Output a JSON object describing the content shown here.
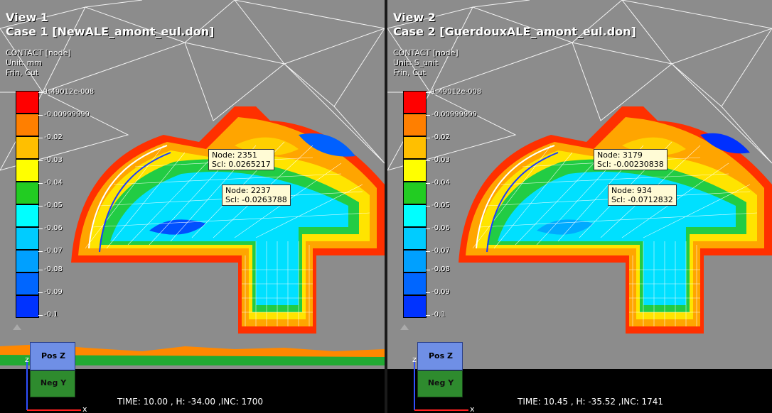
{
  "legend_levels": [
    {
      "label": "1.49012e-008",
      "color": "#ff0000"
    },
    {
      "label": "-0.00999999",
      "color": "#ff7f00"
    },
    {
      "label": "-0.02",
      "color": "#ffbf00"
    },
    {
      "label": "-0.03",
      "color": "#ffff00"
    },
    {
      "label": "-0.04",
      "color": "#22cc22"
    },
    {
      "label": "-0.05",
      "color": "#00ffff"
    },
    {
      "label": "-0.06",
      "color": "#00ccff"
    },
    {
      "label": "-0.07",
      "color": "#00a0ff"
    },
    {
      "label": "-0.08",
      "color": "#0066ff"
    },
    {
      "label": "-0.09",
      "color": "#0033ff"
    },
    {
      "label": "-0.1",
      "color": "#0000ff"
    }
  ],
  "views": [
    {
      "title": "View 1",
      "case": "Case 1  [NewALE_amont_eul.don]",
      "field": "CONTACT [node]",
      "unit": "Unit: mm",
      "filter": "Frin, Cut",
      "tips": [
        {
          "node": "Node: 2351",
          "scl": "Scl: 0.0265217"
        },
        {
          "node": "Node: 2237",
          "scl": "Scl: -0.0263788"
        }
      ],
      "status": {
        "time": "TIME:  10.00",
        "h": ", H: -34.00",
        "inc": ",INC:   1700"
      }
    },
    {
      "title": "View 2",
      "case": "Case 2  [GuerdouxALE_amont_eul.don]",
      "field": "CONTACT [node]",
      "unit": "Unit: S_unit",
      "filter": "Frin, Cut",
      "tips": [
        {
          "node": "Node: 3179",
          "scl": "Scl: -0.00230838"
        },
        {
          "node": "Node: 934",
          "scl": "Scl: -0.0712832"
        }
      ],
      "status": {
        "time": "TIME:  10.45",
        "h": ", H: -35.52",
        "inc": ",INC:  1741"
      }
    }
  ],
  "orientation_cube": {
    "top": "Pos Z",
    "front": "Neg Y",
    "axis_x": "x",
    "axis_z": "z"
  },
  "colors": {
    "background": "#8c8c8c",
    "mesh_line": "#ffffff",
    "tooltip_bg": "#fffbd5"
  }
}
